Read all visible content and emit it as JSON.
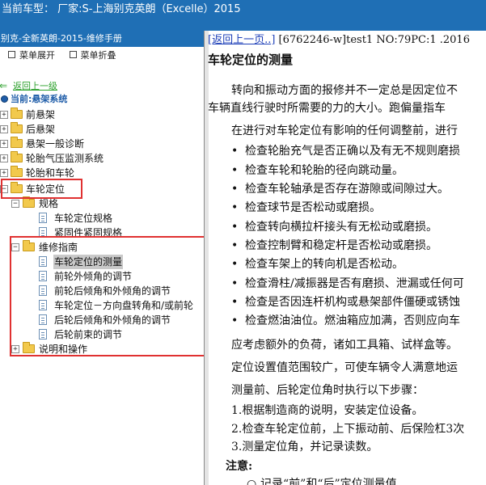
{
  "window": {
    "title": "当前车型：  厂家:S-上海别克英朗（Excelle）2015"
  },
  "left_panel": {
    "header": "别克-全新英朗-2015-维修手册",
    "toolbar": {
      "expand": "菜单展开",
      "collapse": "菜单折叠"
    },
    "back": "返回上一级",
    "current": "当前:悬架系统",
    "tree": [
      {
        "label": "前悬架",
        "level": 1,
        "expander": "+"
      },
      {
        "label": "后悬架",
        "level": 1,
        "expander": "+"
      },
      {
        "label": "悬架一般诊断",
        "level": 1,
        "expander": "+"
      },
      {
        "label": "轮胎气压监测系统",
        "level": 1,
        "expander": "+"
      },
      {
        "label": "轮胎和车轮",
        "level": 1,
        "expander": "+"
      },
      {
        "label": "车轮定位",
        "level": 1,
        "expander": "−"
      },
      {
        "label": "规格",
        "level": 2,
        "expander": "−"
      },
      {
        "label": "车轮定位规格",
        "level": 3
      },
      {
        "label": "紧固件紧固规格",
        "level": 3
      },
      {
        "label": "维修指南",
        "level": 2,
        "expander": "−"
      },
      {
        "label": "车轮定位的测量",
        "level": 3,
        "selected": true
      },
      {
        "label": "前轮外倾角的调节",
        "level": 3
      },
      {
        "label": "前轮后倾角和外倾角的调节",
        "level": 3
      },
      {
        "label": "车轮定位－方向盘转角和/或前轮",
        "level": 3
      },
      {
        "label": "后轮后倾角和外倾角的调节",
        "level": 3
      },
      {
        "label": "后轮前束的调节",
        "level": 3
      },
      {
        "label": "说明和操作",
        "level": 2,
        "expander": "+"
      }
    ]
  },
  "content": {
    "nav_link": "[返回上一页..]",
    "doc_info": " [6762246-w]test1 NO:79PC:1 .2016",
    "title": "车轮定位的测量",
    "para1": "转向和振动方面的报修并不一定总是因定位不",
    "para1_cont": "车辆直线行驶时所需要的力的大小。跑偏量指车",
    "para2": "在进行对车轮定位有影响的任何调整前，进行",
    "bullets": [
      "检查轮胎充气是否正确以及有无不规则磨损",
      "检查车轮和轮胎的径向跳动量。",
      "检查车轮轴承是否存在游隙或间隙过大。",
      "检查球节是否松动或磨损。",
      "检查转向横拉杆接头有无松动或磨损。",
      "检查控制臂和稳定杆是否松动或磨损。",
      "检查车架上的转向机是否松动。",
      "检查滑柱/减振器是否有磨损、泄漏或任何可",
      "检查是否因连杆机构或悬架部件僵硬或锈蚀",
      "检查燃油油位。燃油箱应加满，否则应向车"
    ],
    "para3": "应考虑额外的负荷，诸如工具箱、试样盒等。",
    "para4": "定位设置值范围较广，可使车辆令人满意地运",
    "para5": "测量前、后轮定位角时执行以下步骤：",
    "steps": [
      "1.根据制造商的说明，安装定位设备。",
      "2.检查车轮定位前，上下振动前、后保险杠3次",
      "3.测量定位角，并记录读数。"
    ],
    "note_label": "注意:",
    "note_item": "记录“前”和“后”定位测量值"
  },
  "colors": {
    "title_bar": "#1f6fb5",
    "highlight_box": "#e03131",
    "link": "#1d3fb8",
    "back_link": "#2ba02b",
    "selected_item_bg": "#c9c9c9"
  }
}
